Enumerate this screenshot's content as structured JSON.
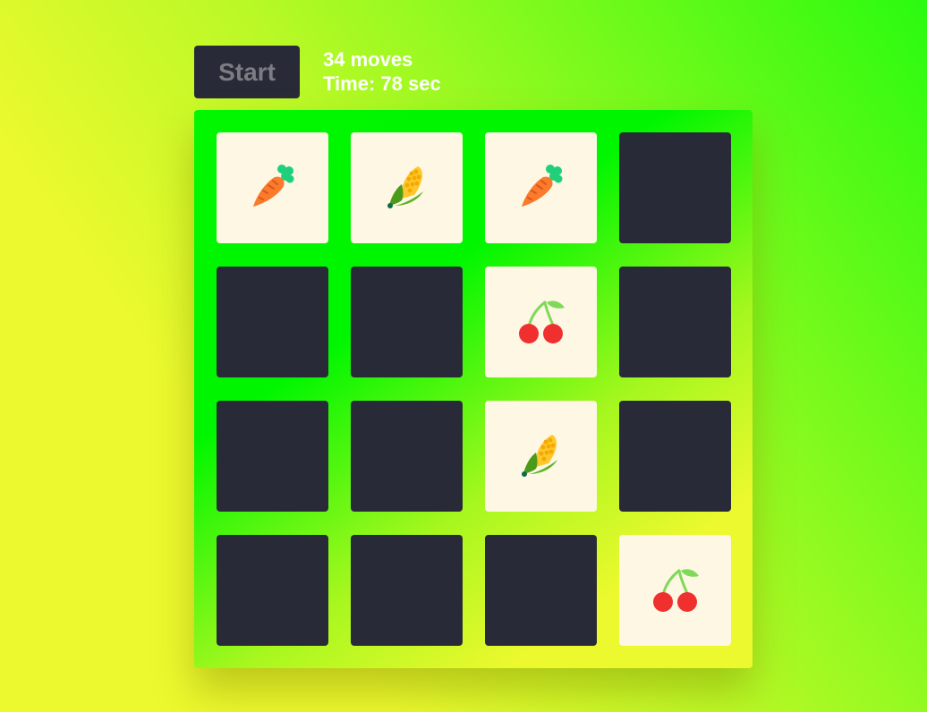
{
  "controls": {
    "start_label": "Start",
    "moves": "34 moves",
    "time": "Time: 78 sec"
  },
  "colors": {
    "card_back": "#292a38",
    "card_face": "#fdf7e4",
    "text": "#ffffff"
  },
  "board": {
    "rows": 4,
    "cols": 4,
    "cards": [
      {
        "state": "face-up",
        "icon": "carrot-icon"
      },
      {
        "state": "face-up",
        "icon": "corn-icon"
      },
      {
        "state": "face-up",
        "icon": "carrot-icon"
      },
      {
        "state": "face-down",
        "icon": ""
      },
      {
        "state": "face-down",
        "icon": ""
      },
      {
        "state": "face-down",
        "icon": ""
      },
      {
        "state": "face-up",
        "icon": "cherry-icon"
      },
      {
        "state": "face-down",
        "icon": ""
      },
      {
        "state": "face-down",
        "icon": ""
      },
      {
        "state": "face-down",
        "icon": ""
      },
      {
        "state": "face-up",
        "icon": "corn-icon"
      },
      {
        "state": "face-down",
        "icon": ""
      },
      {
        "state": "face-down",
        "icon": ""
      },
      {
        "state": "face-down",
        "icon": ""
      },
      {
        "state": "face-down",
        "icon": ""
      },
      {
        "state": "face-up",
        "icon": "cherry-icon"
      }
    ]
  }
}
